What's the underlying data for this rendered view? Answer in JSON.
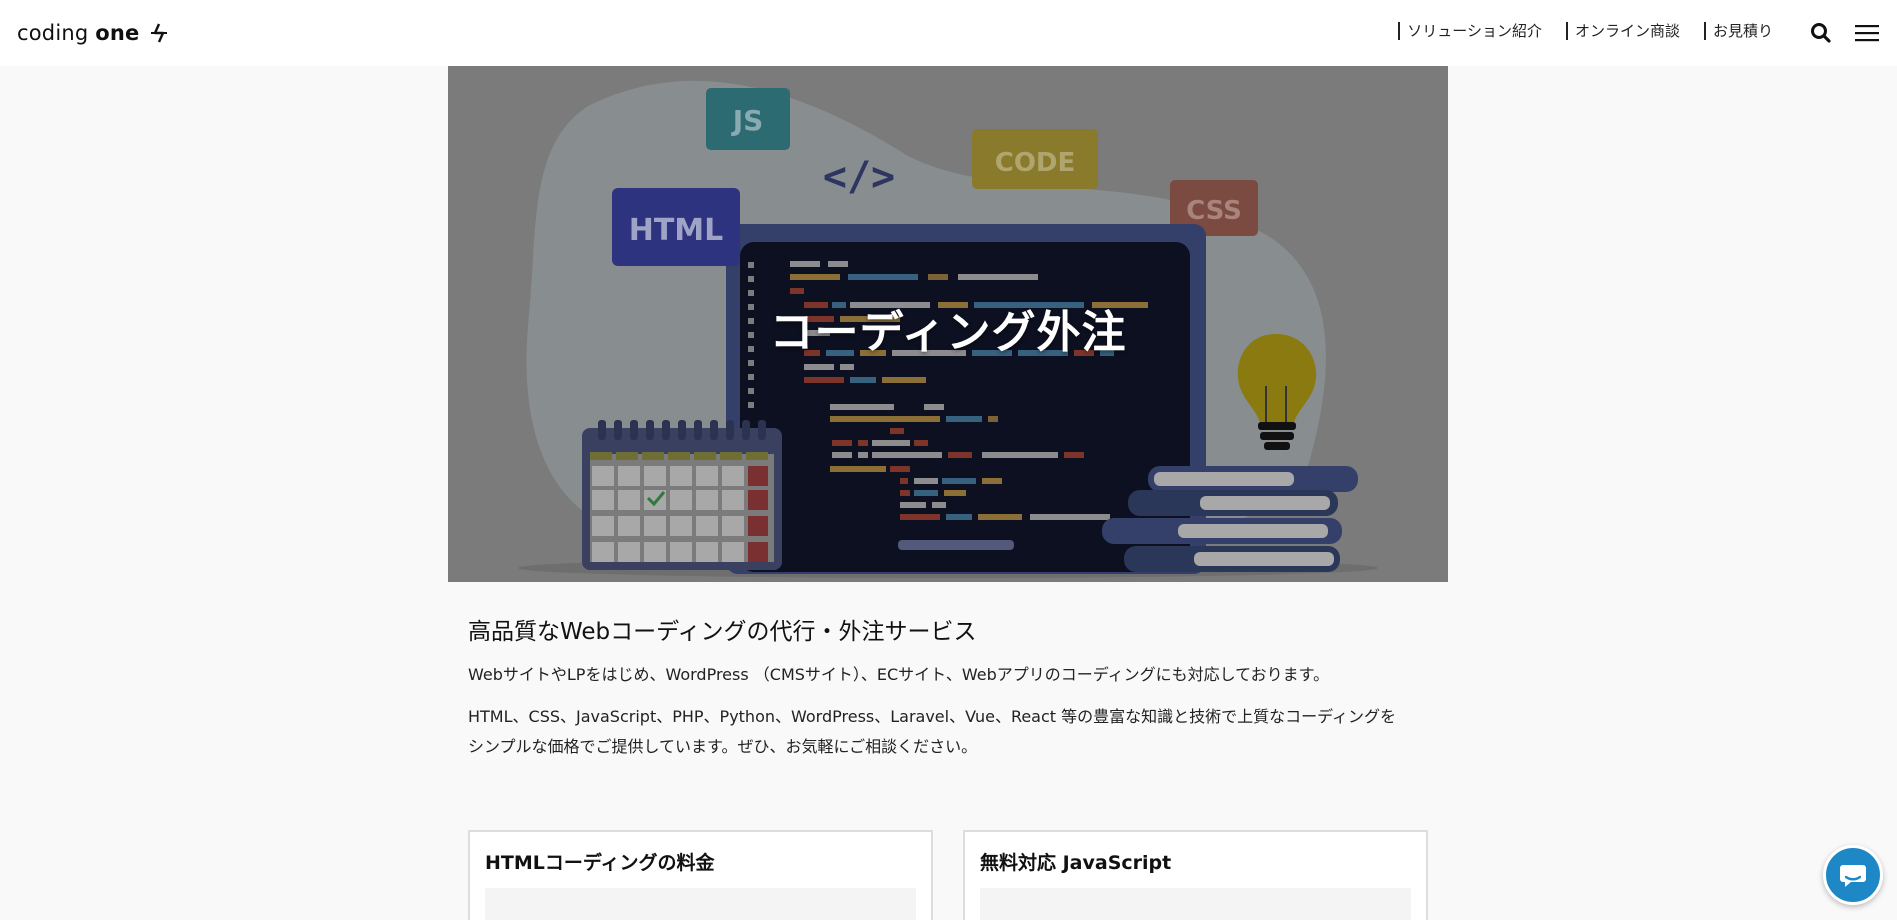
{
  "header": {
    "logo_text_light": "coding ",
    "logo_text_bold": "one",
    "nav": [
      "ソリューション紹介",
      "オンライン商談",
      "お見積り"
    ]
  },
  "hero": {
    "title": "コーディング外注",
    "badges": {
      "js": "JS",
      "code": "CODE",
      "html": "HTML",
      "css": "CSS",
      "tag": "</>"
    }
  },
  "content": {
    "heading": "高品質なWebコーディングの代行・外注サービス",
    "paragraph1": "WebサイトやLPをはじめ、WordPress （CMSサイト）、ECサイト、Webアプリのコーディングにも対応しております。",
    "paragraph2_line1": "HTML、CSS、JavaScript、PHP、Python、WordPress、Laravel、Vue、React 等の豊富な知識と技術で上質なコーディングを",
    "paragraph2_line2": "シンプルな価格でご提供しています。ぜひ、お気軽にご相談ください。"
  },
  "cards": [
    {
      "title": "HTMLコーディングの料金"
    },
    {
      "title": "無料対応 JavaScript"
    }
  ],
  "colors": {
    "accent": "#1e88c7",
    "hero_overlay": "#7b7b7b"
  }
}
